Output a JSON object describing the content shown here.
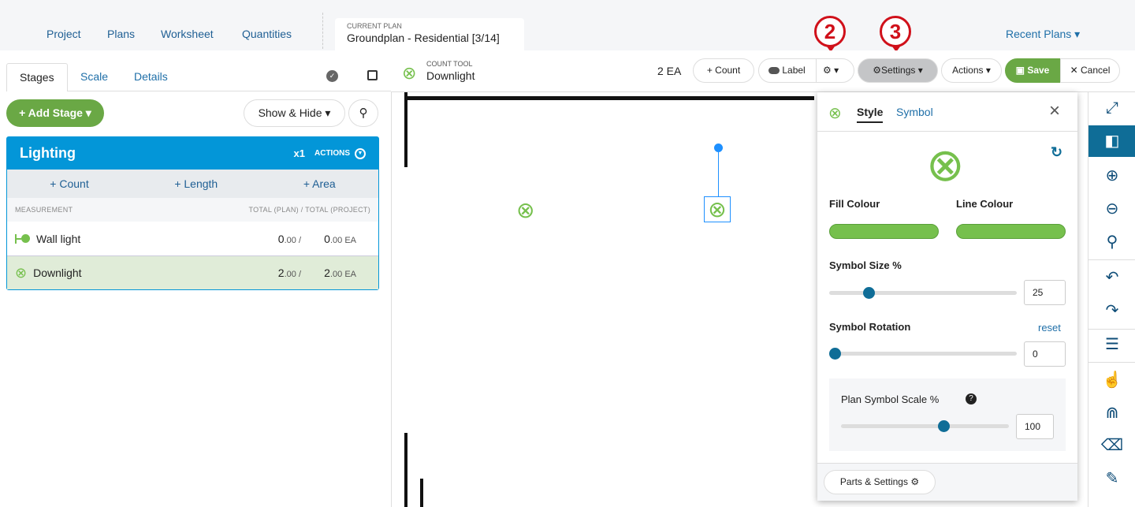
{
  "nav": {
    "items": [
      "Project",
      "Plans",
      "Worksheet",
      "Quantities"
    ],
    "current_plan_label": "CURRENT PLAN",
    "current_plan": "Groundplan - Residential [3/14]",
    "recent": "Recent Plans ▾"
  },
  "markers": [
    "2",
    "3"
  ],
  "left": {
    "tabs": [
      "Stages",
      "Scale",
      "Details"
    ],
    "add_stage": "+ Add Stage ▾",
    "show_hide": "Show & Hide ▾",
    "stage": {
      "title": "Lighting",
      "multiplier": "x1",
      "actions": "ACTIONS",
      "add": [
        "+ Count",
        "+ Length",
        "+ Area"
      ],
      "col_measurement": "MEASUREMENT",
      "col_totals": "TOTAL (PLAN) / TOTAL (PROJECT)",
      "rows": [
        {
          "name": "Wall light",
          "plan": "0",
          "plan_dec": ".00 /",
          "project": "0",
          "project_dec": ".00 EA",
          "icon": "wall-light-icon"
        },
        {
          "name": "Downlight",
          "plan": "2",
          "plan_dec": ".00 /",
          "project": "2",
          "project_dec": ".00 EA",
          "icon": "downlight-icon",
          "selected": true
        }
      ]
    }
  },
  "toolbar": {
    "tool_label": "COUNT TOOL",
    "tool_name": "Downlight",
    "count": "2 EA",
    "count_btn": "+ Count",
    "label_btn": "Label",
    "settings": "Settings ▾",
    "actions": "Actions ▾",
    "save": "Save",
    "cancel": "✕ Cancel"
  },
  "panel": {
    "tabs": [
      "Style",
      "Symbol"
    ],
    "fill_label": "Fill Colour",
    "line_label": "Line Colour",
    "fill_colour": "#76c04d",
    "line_colour": "#76c04d",
    "size_label": "Symbol Size %",
    "size": "25",
    "rotation_label": "Symbol Rotation",
    "reset": "reset",
    "rotation": "0",
    "scale_label": "Plan Symbol Scale %",
    "scale": "100",
    "parts": "Parts & Settings"
  },
  "colors": {
    "accent": "#0396d8",
    "green": "#6aa845",
    "marker": "#d0101a"
  }
}
